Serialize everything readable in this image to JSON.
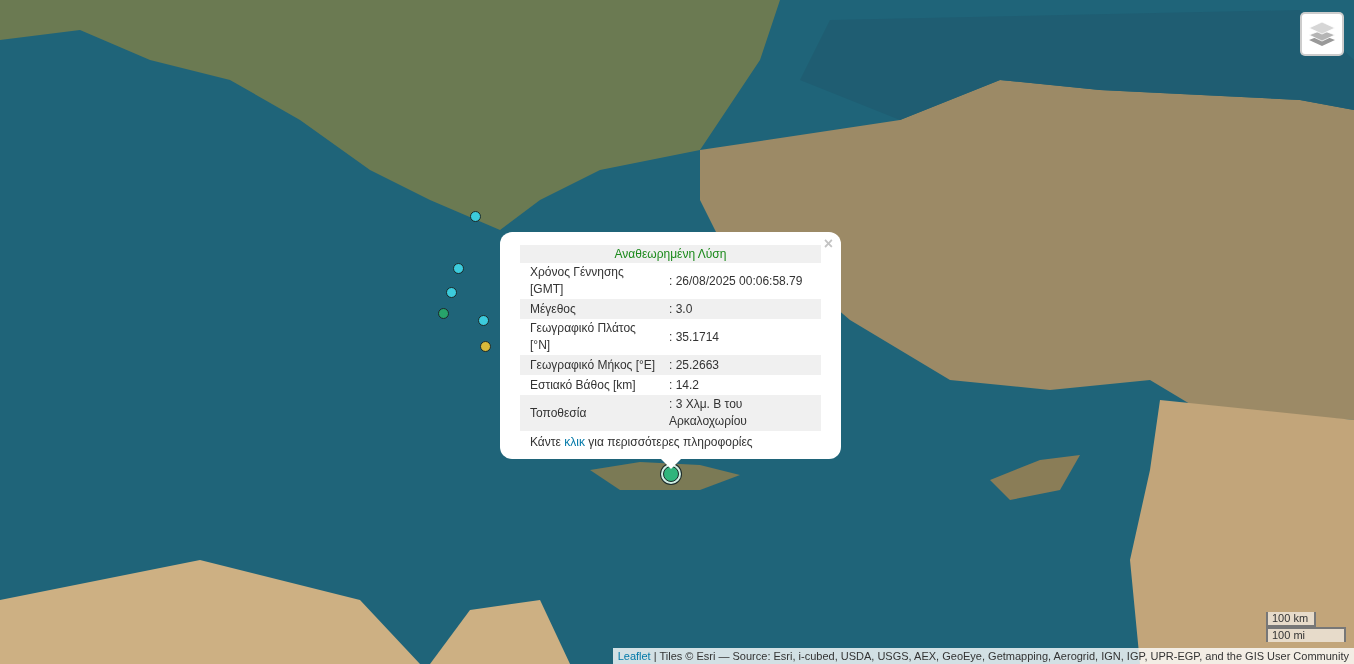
{
  "map": {
    "markers": [
      {
        "color": "#3ccbdc",
        "selected": false
      },
      {
        "color": "#3ccbdc",
        "selected": false
      },
      {
        "color": "#3ccbdc",
        "selected": false
      },
      {
        "color": "#27a36a",
        "selected": false
      },
      {
        "color": "#3ccbdc",
        "selected": false
      },
      {
        "color": "#d8b93a",
        "selected": false
      },
      {
        "color": "#2fb57c",
        "selected": true
      }
    ]
  },
  "popup": {
    "title": "Αναθεωρημένη Λύση",
    "rows": [
      {
        "label": "Χρόνος Γέννησης [GMT]",
        "value": ": 26/08/2025 00:06:58.79"
      },
      {
        "label": "Μέγεθος",
        "value": ": 3.0"
      },
      {
        "label": "Γεωγραφικό Πλάτος [°N]",
        "value": ": 35.1714"
      },
      {
        "label": "Γεωγραφικό Μήκος [°E]",
        "value": ": 25.2663"
      },
      {
        "label": "Εστιακό Βάθος [km]",
        "value": ": 14.2"
      },
      {
        "label": "Τοποθεσία",
        "value": ": 3 Χλμ. Β του Αρκαλοχωρίου"
      }
    ],
    "footer_before": "Κάντε",
    "footer_link": "κλικ",
    "footer_after": "για περισσότερες πληροφορίες",
    "close": "×"
  },
  "scale": {
    "metric": "100 km",
    "imperial": "100 mi"
  },
  "attribution": {
    "link": "Leaflet",
    "text": "| Tiles © Esri — Source: Esri, i-cubed, USDA, USGS, AEX, GeoEye, Getmapping, Aerogrid, IGN, IGP, UPR-EGP, and the GIS User Community"
  }
}
